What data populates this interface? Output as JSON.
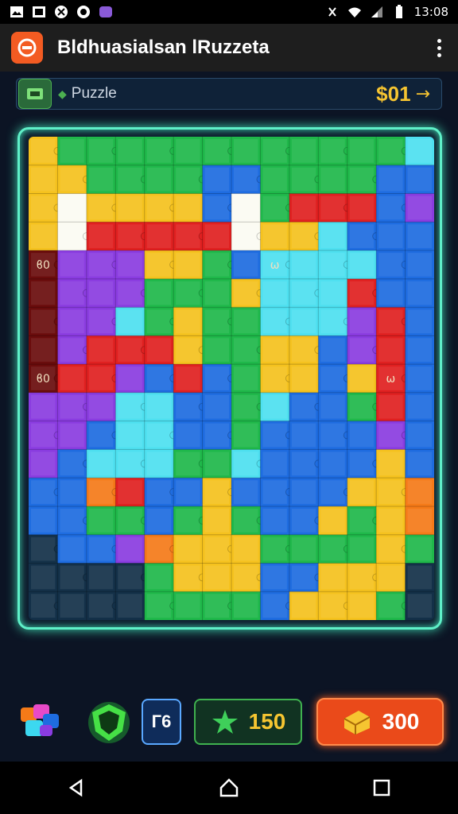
{
  "status": {
    "time": "13:08",
    "icons": [
      "gallery-icon",
      "photo-icon",
      "tool-icon",
      "chat-icon",
      "app-icon",
      "vibrate-icon",
      "wifi-icon",
      "signal-icon",
      "battery-icon"
    ]
  },
  "app": {
    "title": "Bldhuasialsan lRuzzeta",
    "icon": "app-logo-icon",
    "menu_icon": "kebab-menu-icon"
  },
  "info": {
    "badge_icon": "screen-icon",
    "label": "Puzzle",
    "value": "$01",
    "arrow": "→"
  },
  "board": {
    "cols": 14,
    "rows": 16,
    "cell_labels": {
      "4-0": "ϐ0",
      "8-0": "ϐ0",
      "8-12": "ω",
      "4-8": "ω"
    },
    "grid": [
      "YGGGGGGGGGGGGC",
      "YYGGGGBBGGGGBB",
      "YWYYYYBWGRRRBP",
      "YWRRRRRWYYCBBB",
      "DPPPYYGBCCCCBB",
      "DPPPGGGYCCCRBB",
      "DPPCGYGGCCCPRB",
      "DPRRRYGGYYBPRB",
      "DRRPBRBGYYBYRB",
      "PPPCCBBGCBBGRB",
      "PPBCCBBGBBBBPB",
      "PBCCCGGCBBBBYB",
      "BBORBBYBBBBYYO",
      "BBGGBGYGBBYGYO",
      "KBBPOYYYGGGGYG",
      "KKKKGYYYBBYYYK",
      "KKKKGGGGBYYYGK"
    ],
    "palette": {
      "Y": "#f5c21e",
      "G": "#1fb84a",
      "B": "#1e6ce0",
      "C": "#4ee0f0",
      "W": "#fbfbf2",
      "R": "#e02020",
      "P": "#8a3ce0",
      "O": "#f57a18",
      "D": "#6a0c0c",
      "K": "#133048"
    }
  },
  "bottom": {
    "pieces_icon": "puzzle-pieces-icon",
    "shield_icon": "green-shield-icon",
    "counter_text": "Г6",
    "score_icon": "star-icon",
    "score": "150",
    "coins_icon": "chest-icon",
    "coins": "300"
  },
  "nav": {
    "back": "back-icon",
    "home": "home-icon",
    "recents": "recents-icon"
  }
}
